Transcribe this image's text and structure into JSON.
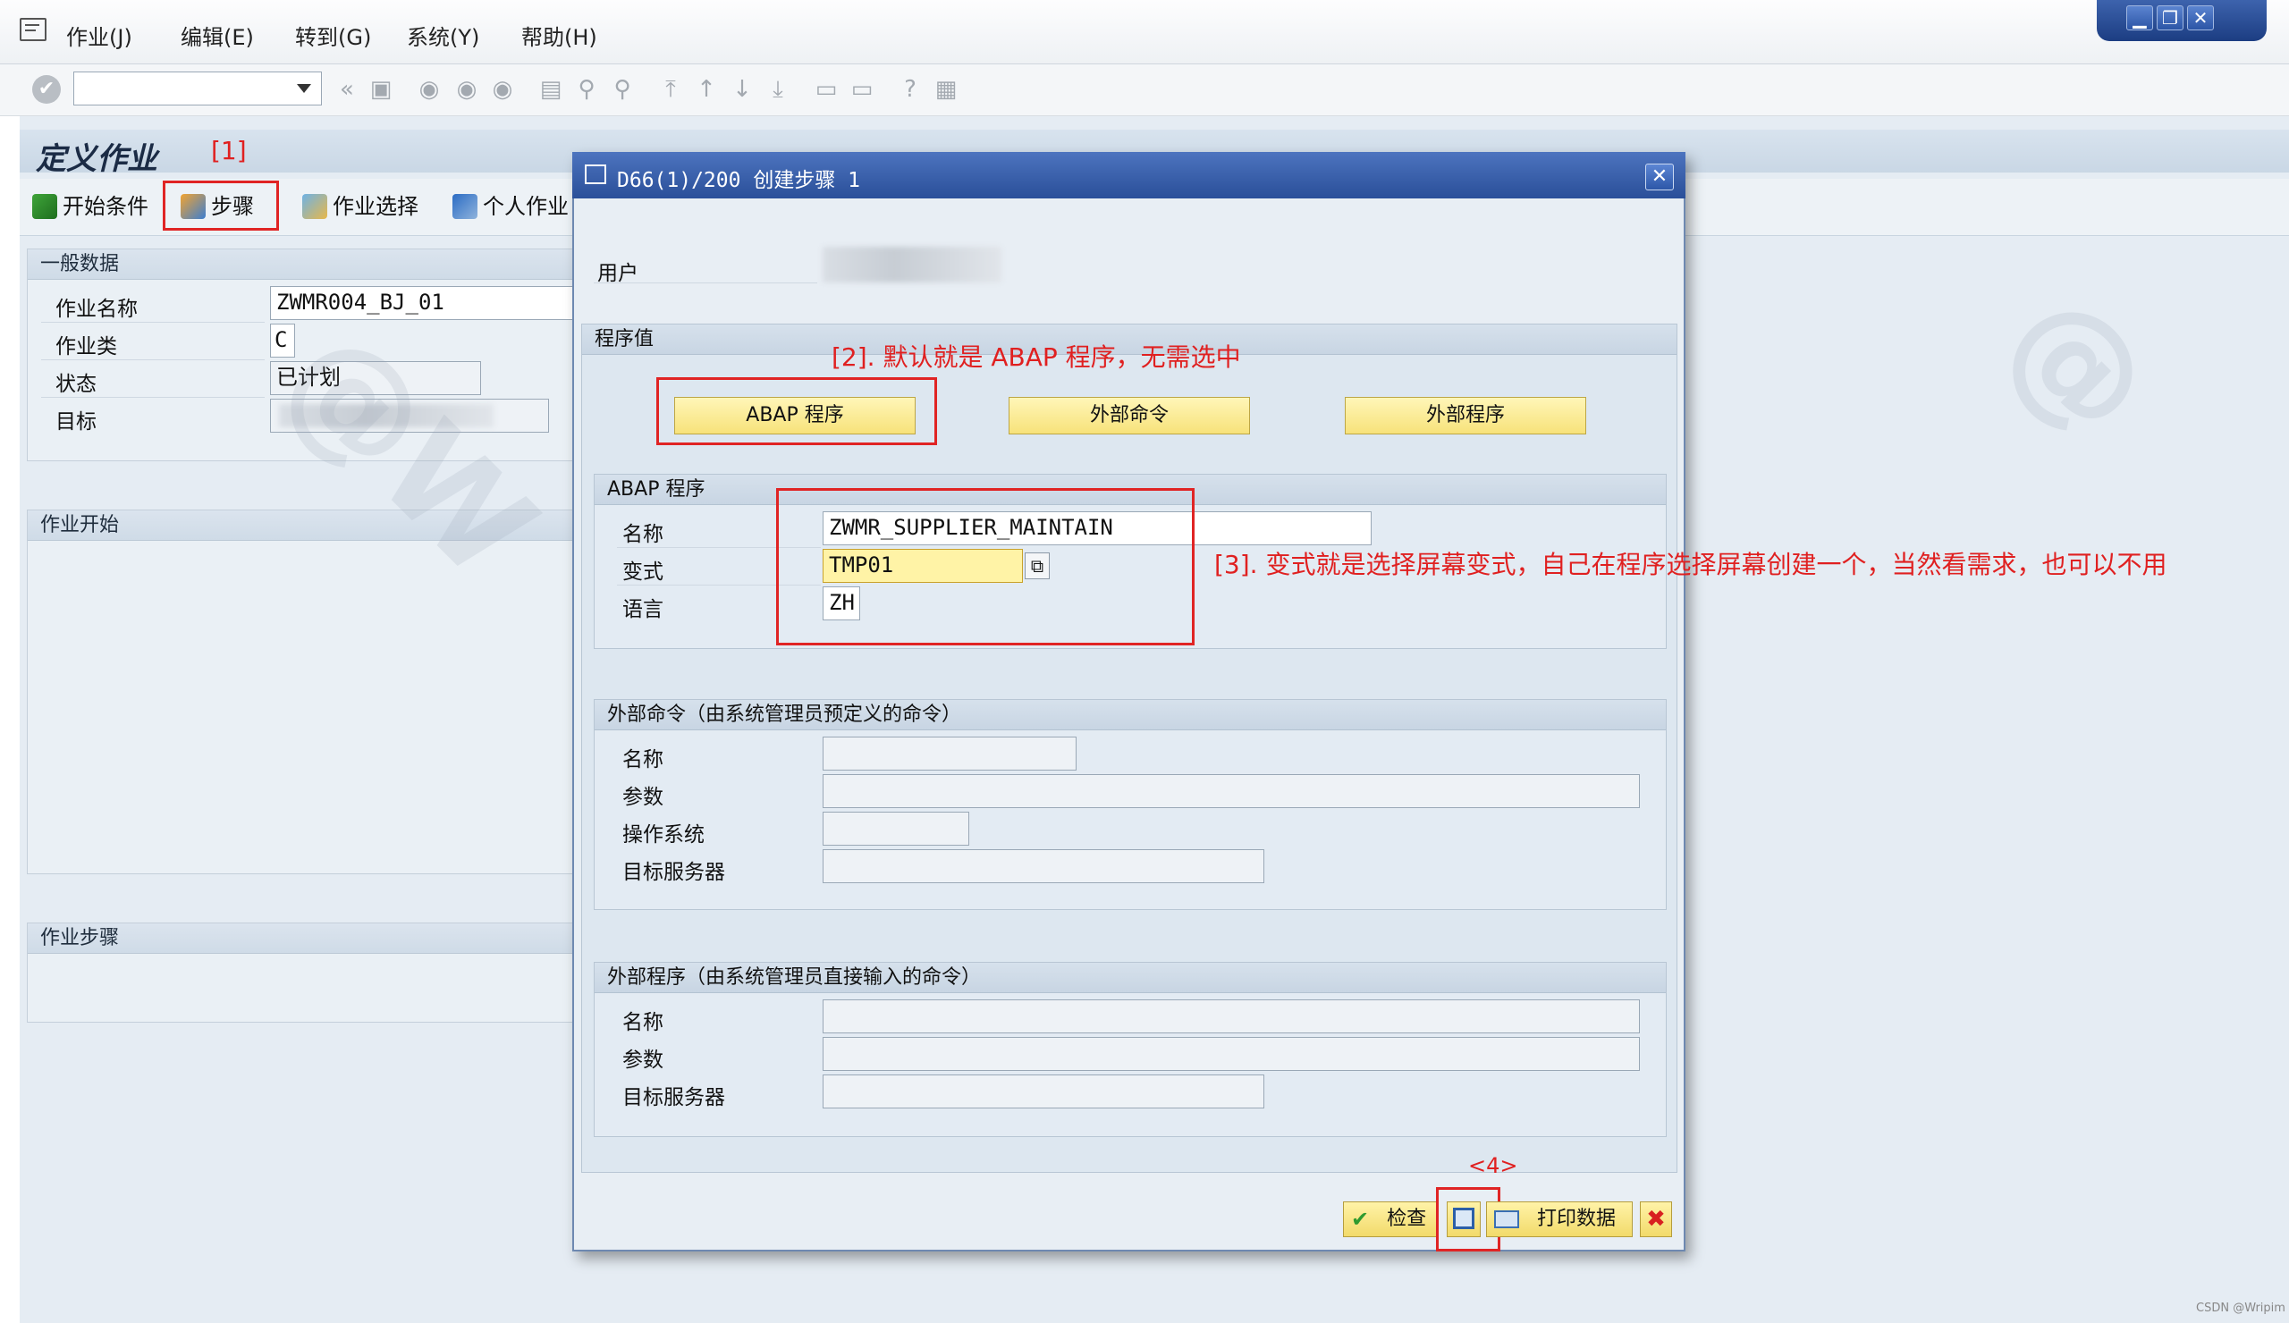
{
  "menu": {
    "items": [
      "作业(J)",
      "编辑(E)",
      "转到(G)",
      "系统(Y)",
      "帮助(H)"
    ]
  },
  "toolbar": {
    "command_field": "",
    "prev_glyph": "«"
  },
  "window": {
    "minimize": "▁",
    "restore": "❐",
    "close": "✕"
  },
  "page": {
    "title": "定义作业",
    "annotation1": "[1]",
    "app_buttons": [
      "开始条件",
      "步骤",
      "作业选择",
      "个人作业"
    ]
  },
  "general": {
    "header": "一般数据",
    "rows": [
      {
        "label": "作业名称",
        "value": "ZWMR004_BJ_01"
      },
      {
        "label": "作业类",
        "value": "C"
      },
      {
        "label": "状态",
        "value": "已计划"
      },
      {
        "label": "目标",
        "value": ""
      }
    ]
  },
  "job_start": {
    "header": "作业开始"
  },
  "job_steps": {
    "header": "作业步骤"
  },
  "dialog": {
    "title": "D66(1)/200 创建步骤  1",
    "close": "✕",
    "user_label": "用户",
    "program_values_header": "程序值",
    "annotation2": "[2]. 默认就是 ABAP 程序，无需选中",
    "buttons": [
      "ABAP 程序",
      "外部命令",
      "外部程序"
    ],
    "abap": {
      "header": "ABAP 程序",
      "name_label": "名称",
      "name_value": "ZWMR_SUPPLIER_MAINTAIN",
      "variant_label": "变式",
      "variant_value": "TMP01",
      "lang_label": "语言",
      "lang_value": "ZH"
    },
    "annotation3": "[3]. 变式就是选择屏幕变式，自己在程序选择屏幕创建一个，当然看需求，也可以不用",
    "ext_cmd": {
      "header": "外部命令（由系统管理员预定义的命令）",
      "labels": [
        "名称",
        "参数",
        "操作系统",
        "目标服务器"
      ]
    },
    "ext_prog": {
      "header": "外部程序（由系统管理员直接输入的命令）",
      "labels": [
        "名称",
        "参数",
        "目标服务器"
      ]
    },
    "annotation4": "<4>",
    "footer": {
      "check": "检查",
      "print": "打印数据"
    }
  },
  "watermark": "CSDN @Wripim",
  "colors": {
    "annotation": "#e02020",
    "dialog_title": "#2a4f99",
    "yellow_button": "#f7e27a"
  }
}
